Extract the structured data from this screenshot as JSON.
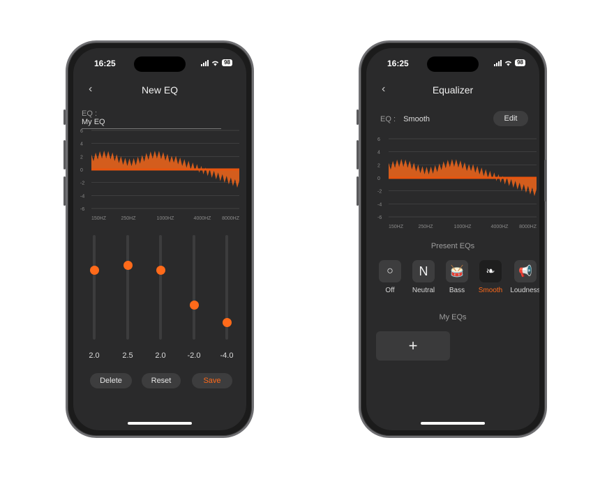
{
  "left_phone": {
    "status": {
      "time": "16:25",
      "battery": "98"
    },
    "title": "New EQ",
    "eq_label": "EQ :",
    "eq_name": "My EQ",
    "chart": {
      "y_ticks": [
        "6",
        "4",
        "2",
        "0",
        "-2",
        "-4",
        "-6"
      ],
      "x_ticks": [
        "150HZ",
        "250HZ",
        "1000HZ",
        "4000HZ",
        "8000HZ"
      ]
    },
    "sliders": [
      {
        "value": "2.0",
        "level": 2.0
      },
      {
        "value": "2.5",
        "level": 2.5
      },
      {
        "value": "2.0",
        "level": 2.0
      },
      {
        "value": "-2.0",
        "level": -2.0
      },
      {
        "value": "-4.0",
        "level": -4.0
      }
    ],
    "buttons": {
      "delete": "Delete",
      "reset": "Reset",
      "save": "Save"
    }
  },
  "right_phone": {
    "status": {
      "time": "16:25",
      "battery": "98"
    },
    "title": "Equalizer",
    "eq_label": "EQ :",
    "eq_name": "Smooth",
    "edit": "Edit",
    "chart": {
      "y_ticks": [
        "6",
        "4",
        "2",
        "0",
        "-2",
        "-4",
        "-6"
      ],
      "x_ticks": [
        "150HZ",
        "250HZ",
        "1000HZ",
        "4000HZ",
        "8000HZ"
      ]
    },
    "presets_title": "Present EQs",
    "presets": [
      {
        "label": "Off",
        "icon": "circle-icon",
        "glyph": "○"
      },
      {
        "label": "Neutral",
        "icon": "neutral-n-icon",
        "glyph": "N"
      },
      {
        "label": "Bass",
        "icon": "drum-icon",
        "glyph": "🥁"
      },
      {
        "label": "Smooth",
        "icon": "feather-icon",
        "glyph": "❧"
      },
      {
        "label": "Loudness",
        "icon": "megaphone-icon",
        "glyph": "📢"
      }
    ],
    "active_preset": "Smooth",
    "my_eqs_title": "My EQs",
    "add_symbol": "+"
  },
  "colors": {
    "accent": "#ff6a1a",
    "screen_bg": "#2a2a2b",
    "control_bg": "#3d3d3e"
  }
}
